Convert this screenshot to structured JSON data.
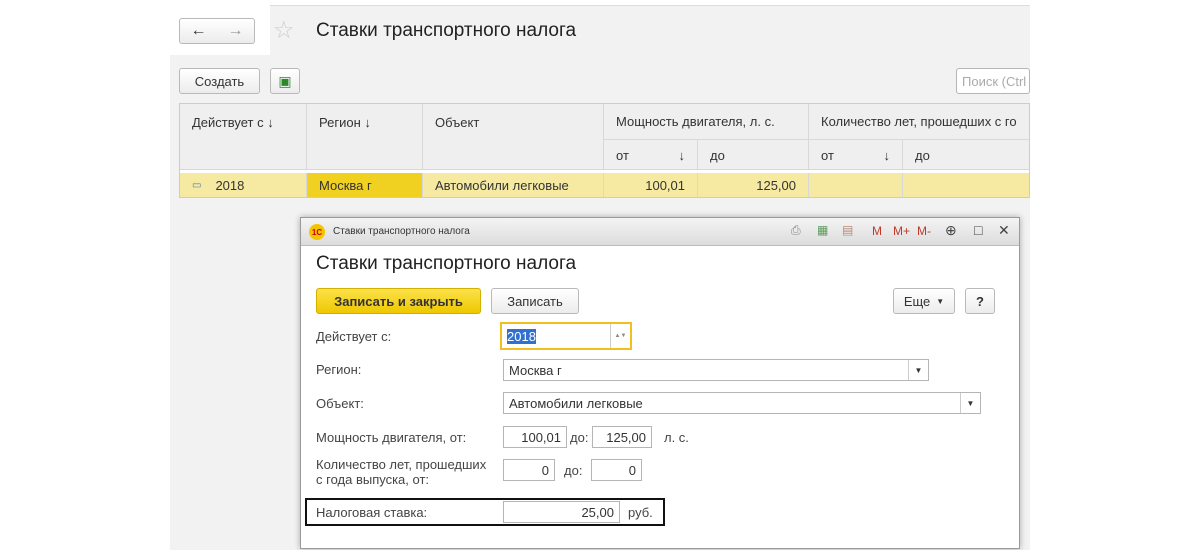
{
  "main": {
    "title": "Ставки транспортного налога",
    "create_label": "Создать",
    "search_placeholder": "Поиск (Ctrl",
    "table": {
      "headers": [
        "Действует с ↓",
        "Регион  ↓",
        "Объект",
        "Мощность двигателя, л. с.",
        "Количество лет, прошедших с го"
      ],
      "subheaders": [
        "от",
        "↓",
        "до",
        "от",
        "↓",
        "до"
      ],
      "row": {
        "date": "2018",
        "region": "Москва г",
        "object": "Автомобили легковые",
        "power_from": "100,01",
        "power_to": "125,00",
        "years_from": "",
        "years_to": ""
      }
    }
  },
  "dialog": {
    "window_title": "Ставки транспортного налога",
    "logo": "1С",
    "toolbar": [
      "M",
      "M+",
      "M-"
    ],
    "heading": "Ставки транспортного налога",
    "save_close": "Записать и закрыть",
    "save": "Записать",
    "more": "Еще",
    "help": "?",
    "fields": {
      "date_label": "Действует с:",
      "date_value": "2018",
      "region_label": "Регион:",
      "region_value": "Москва г",
      "object_label": "Объект:",
      "object_value": "Автомобили легковые",
      "power_label": "Мощность двигателя, от:",
      "power_from": "100,01",
      "to_label": "до:",
      "power_to": "125,00",
      "power_unit": "л. с.",
      "years_label_1": "Количество лет, прошедших",
      "years_label_2": "с года выпуска, от:",
      "years_from": "0",
      "years_to": "0",
      "rate_label": "Налоговая ставка:",
      "rate_value": "25,00",
      "rate_unit": "руб."
    }
  }
}
